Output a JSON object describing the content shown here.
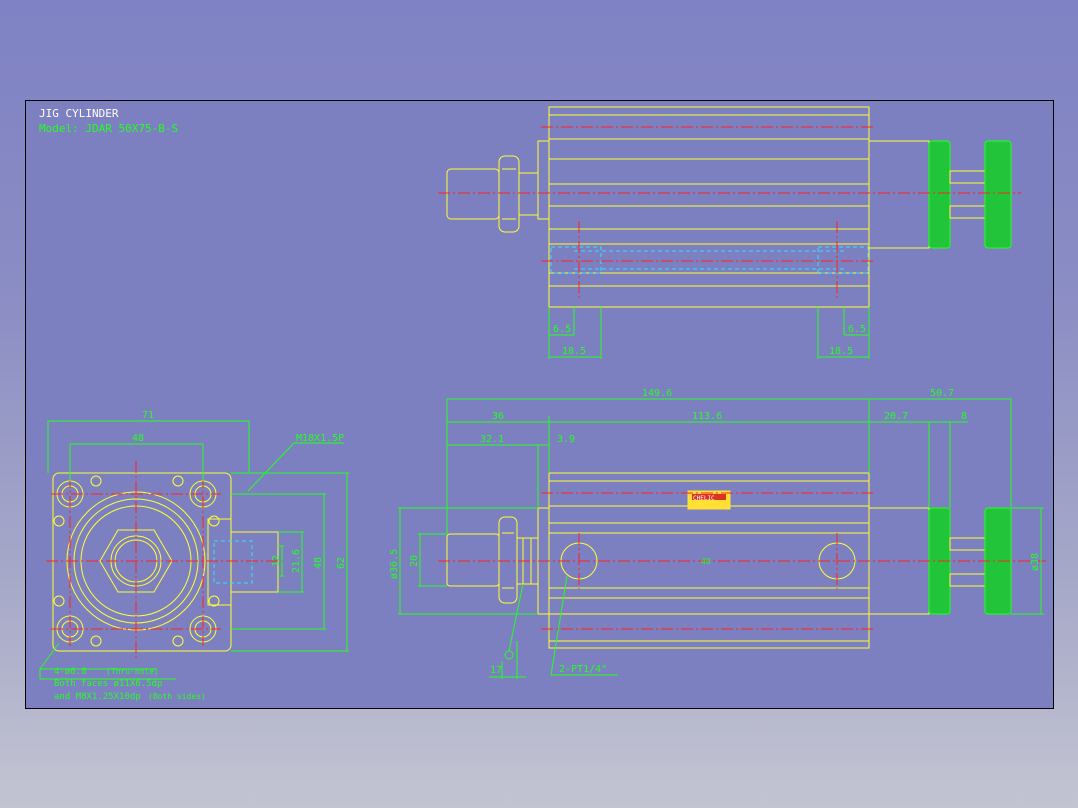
{
  "title_block": {
    "title": "JIG CYLINDER",
    "model": "Model: JDAR 50X75-B-S"
  },
  "colors": {
    "background": "#7d80c0",
    "outline": "#ffff33",
    "dimension": "#22ff22",
    "hidden": "#33e0ff",
    "centerline": "#ff2222"
  },
  "top_view": {
    "dims": {
      "left_small": "6.5",
      "left_wide": "18.5",
      "right_small": "6.5",
      "right_wide": "18.5"
    }
  },
  "end_view": {
    "dims": {
      "width_outer": "71",
      "width_inner": "48",
      "thread": "M18X1.5P",
      "d1": "12",
      "d2": "21.6",
      "height_inner": "48",
      "height_outer": "62"
    },
    "notes": {
      "line1": "4-ø6.8",
      "line1b": "(Thru-hole)",
      "line2": "Both faces ø11X6.5dp",
      "line3": "and M8X1.25X10dp",
      "line3b": "(Both sides)"
    }
  },
  "side_view": {
    "dims": {
      "overall": "149.6",
      "right_overall": "50.7",
      "rod_length": "36",
      "body_length": "113.6",
      "knob1": "20.7",
      "knob2": "8",
      "rod_end": "32.1",
      "gap": "3.9",
      "rod_dia": "ø36.5",
      "rod_dia2": "20",
      "knob_dia": "ø38",
      "wrench": "17",
      "port": "2-PT1/4\"",
      "center_mark": "40"
    },
    "label": {
      "brand": "CHELIC"
    }
  }
}
